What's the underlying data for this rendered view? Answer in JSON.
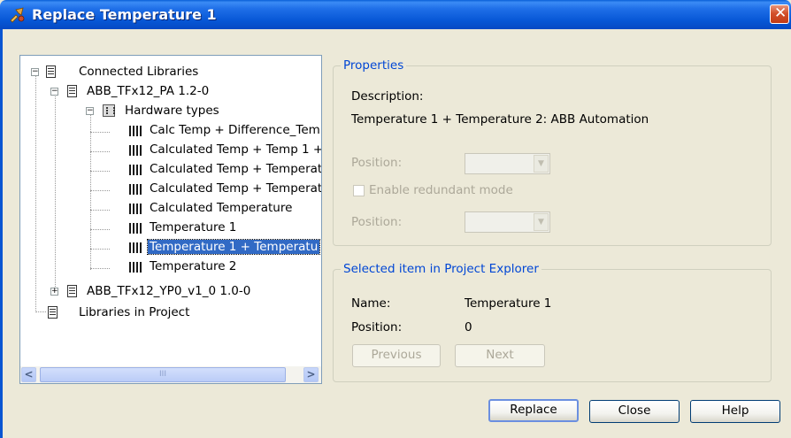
{
  "window": {
    "title": "Replace Temperature 1",
    "close_glyph": "✕"
  },
  "tree": {
    "connected_libraries": "Connected Libraries",
    "lib1": "ABB_TFx12_PA 1.2-0",
    "hardware_types": "Hardware types",
    "items": [
      "Calc Temp + Difference_Tem",
      "Calculated Temp + Temp 1 +",
      "Calculated Temp + Temperat",
      "Calculated Temp + Temperat",
      "Calculated Temperature",
      "Temperature 1",
      "Temperature 1 + Temperatu",
      "Temperature 2"
    ],
    "lib2": "ABB_TFx12_YP0_v1_0 1.0-0",
    "libraries_in_project": "Libraries in Project",
    "selected_index": 6,
    "scroll_left": "<",
    "scroll_right": ">",
    "scroll_grip": "III"
  },
  "properties": {
    "title": "Properties",
    "description_label": "Description:",
    "description_value": "Temperature 1 + Temperature 2: ABB Automation",
    "position_label_1": "Position:",
    "redundant_label": "Enable redundant mode",
    "position_label_2": "Position:",
    "combo_arrow": "▼"
  },
  "selected": {
    "title": "Selected item in Project Explorer",
    "name_label": "Name:",
    "name_value": "Temperature 1",
    "position_label": "Position:",
    "position_value": "0",
    "previous_button": "Previous",
    "next_button": "Next"
  },
  "buttons": {
    "replace": "Replace",
    "close": "Close",
    "help": "Help"
  },
  "colors": {
    "title_bar": "#0757D6",
    "group_title": "#0046D5",
    "selection": "#316AC5",
    "dialog_bg": "#ECE9D8"
  }
}
